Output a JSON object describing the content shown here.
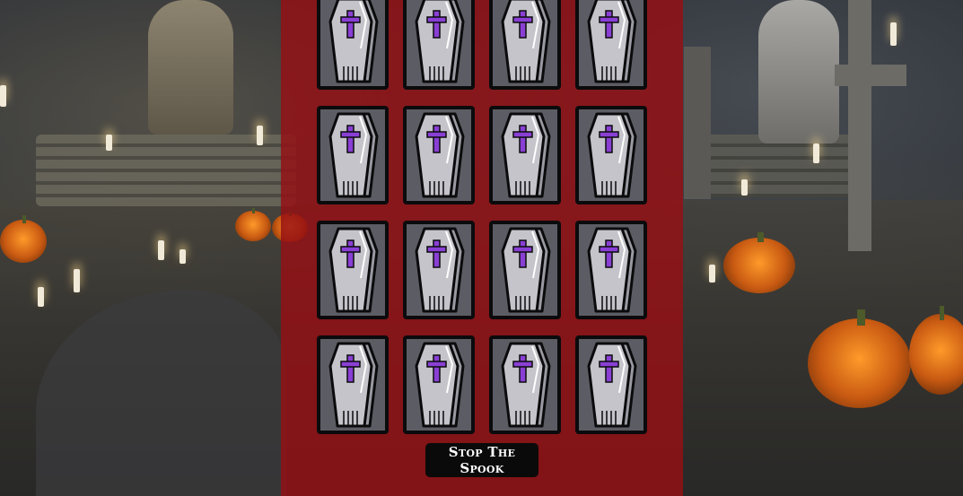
{
  "game": {
    "stop_button_label": "Stop The Spook",
    "card_count": 16,
    "card_back_icon": "coffin-icon",
    "colors": {
      "panel": "#960f14",
      "card_bg": "#5c5d64",
      "coffin_body": "#c4c4ca",
      "cross": "#8a3fd4",
      "button_bg": "#0a0a0a"
    }
  }
}
